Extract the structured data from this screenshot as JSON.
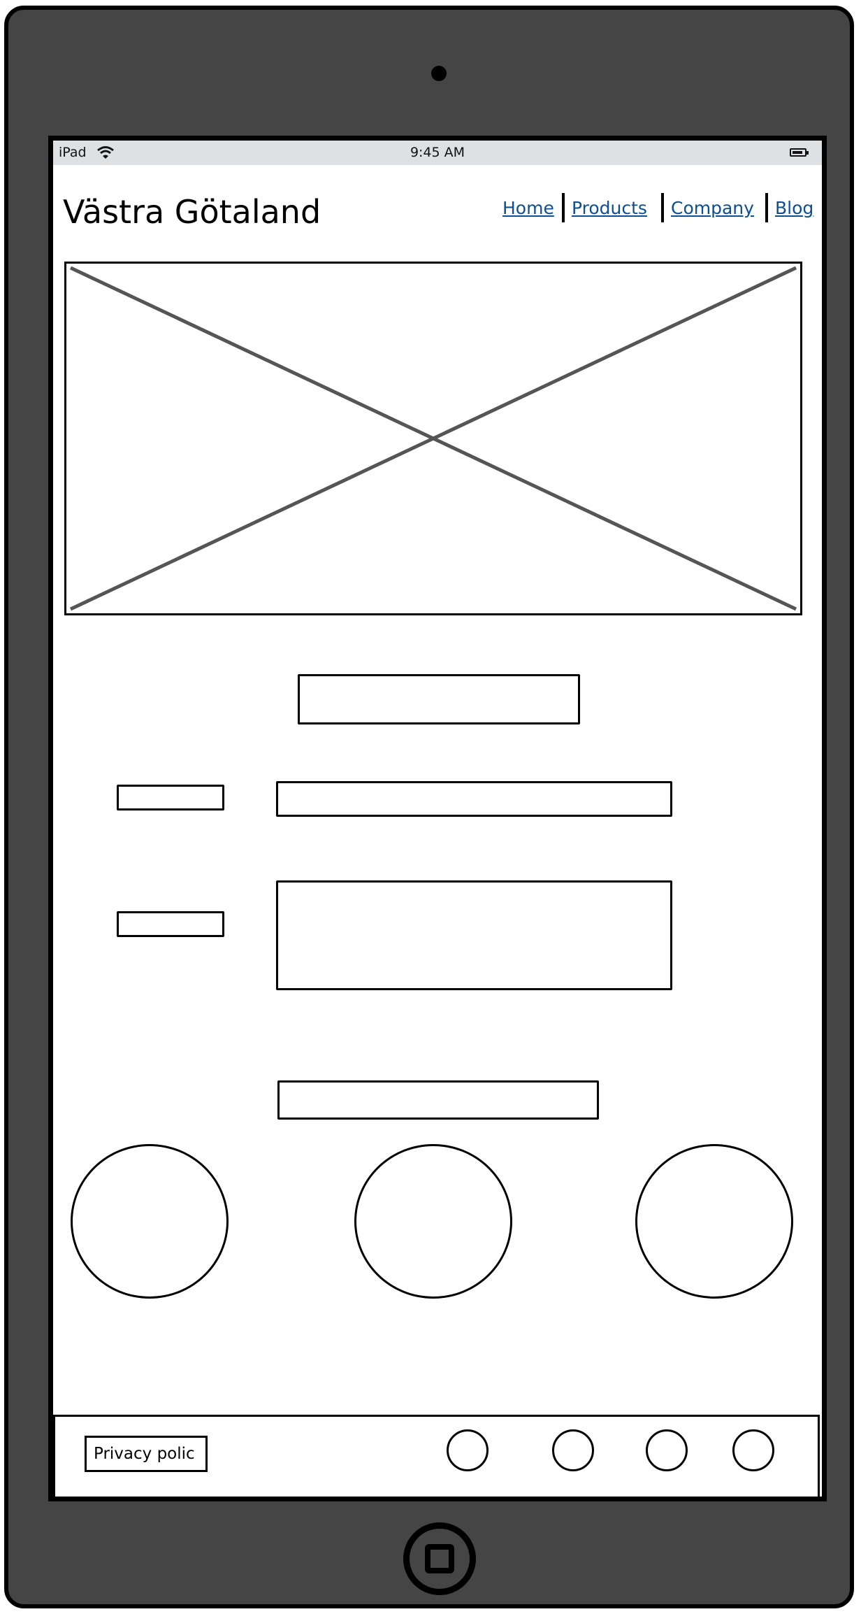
{
  "status_bar": {
    "device": "iPad",
    "time": "9:45 AM",
    "wifi_icon": "wifi-icon",
    "battery_icon": "battery-icon"
  },
  "header": {
    "title": "Västra Götaland"
  },
  "nav": {
    "items": [
      {
        "label": "Home"
      },
      {
        "label": "Products"
      },
      {
        "label": "Company"
      },
      {
        "label": "Blog"
      }
    ]
  },
  "footer": {
    "privacy_label": "Privacy polic",
    "social_icons": [
      "social-icon",
      "social-icon",
      "social-icon",
      "social-icon"
    ]
  },
  "colors": {
    "link": "#0b4f94",
    "device_frame": "#454545",
    "status_bar": "#dde1e4"
  }
}
